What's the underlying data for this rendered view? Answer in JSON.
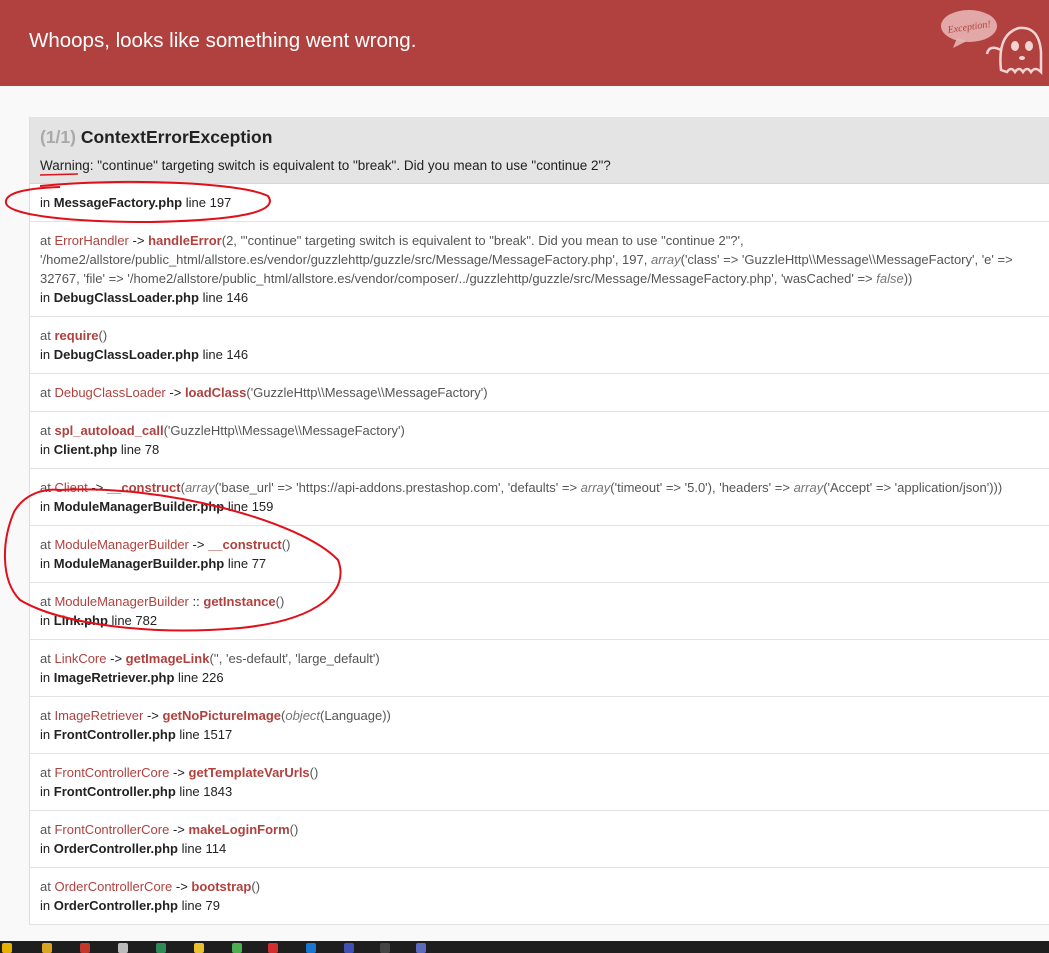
{
  "header": {
    "title": "Whoops, looks like something went wrong.",
    "mascot_text": "Exception!",
    "background_color": "#b0413e"
  },
  "exception": {
    "count": "(1/1)",
    "name": "ContextErrorException",
    "message": "Warning: \"continue\" targeting switch is equivalent to \"break\". Did you mean to use \"continue 2\"?"
  },
  "trace": [
    {
      "type": "location",
      "in": "in",
      "file": "MessageFactory.php",
      "line": "line 197"
    },
    {
      "type": "call",
      "at": "at",
      "class": "ErrorHandler",
      "sep": "->",
      "function": "handleError",
      "args": [
        {
          "t": "(2, '\"continue\" targeting switch is equivalent to \"break\". Did you mean to use \"continue 2\"?', '/home2/allstore/public_html/allstore.es/vendor/guzzlehttp/guzzle/src/Message/MessageFactory.php', 197, "
        },
        {
          "t": "array",
          "i": true
        },
        {
          "t": "('class' => 'GuzzleHttp\\\\Message\\\\MessageFactory', 'e' => 32767, 'file' => '/home2/allstore/public_html/allstore.es/vendor/composer/../guzzlehttp/guzzle/src/Message/MessageFactory.php', 'wasCached' => "
        },
        {
          "t": "false",
          "i": true
        },
        {
          "t": "))"
        }
      ],
      "in": "in",
      "file": "DebugClassLoader.php",
      "line": "line 146"
    },
    {
      "type": "call",
      "at": "at",
      "class": "",
      "sep": "",
      "function": "require",
      "args": [
        {
          "t": "()"
        }
      ],
      "in": "in",
      "file": "DebugClassLoader.php",
      "line": "line 146"
    },
    {
      "type": "call",
      "at": "at",
      "class": "DebugClassLoader",
      "sep": "->",
      "function": "loadClass",
      "args": [
        {
          "t": "('GuzzleHttp\\\\Message\\\\MessageFactory')"
        }
      ],
      "in": "",
      "file": "",
      "line": ""
    },
    {
      "type": "call",
      "at": "at",
      "class": "",
      "sep": "",
      "function": "spl_autoload_call",
      "args": [
        {
          "t": "('GuzzleHttp\\\\Message\\\\MessageFactory')"
        }
      ],
      "in": "in",
      "file": "Client.php",
      "line": "line 78"
    },
    {
      "type": "call",
      "at": "at",
      "class": "Client",
      "sep": "->",
      "function": "__construct",
      "args": [
        {
          "t": "("
        },
        {
          "t": "array",
          "i": true
        },
        {
          "t": "('base_url' => 'https://api-addons.prestashop.com', 'defaults' => "
        },
        {
          "t": "array",
          "i": true
        },
        {
          "t": "('timeout' => '5.0'), 'headers' => "
        },
        {
          "t": "array",
          "i": true
        },
        {
          "t": "('Accept' => 'application/json')))"
        }
      ],
      "in": "in",
      "file": "ModuleManagerBuilder.php",
      "line": "line 159"
    },
    {
      "type": "call",
      "at": "at",
      "class": "ModuleManagerBuilder",
      "sep": "->",
      "function": "__construct",
      "args": [
        {
          "t": "()"
        }
      ],
      "in": "in",
      "file": "ModuleManagerBuilder.php",
      "line": "line 77"
    },
    {
      "type": "call",
      "at": "at",
      "class": "ModuleManagerBuilder",
      "sep": "::",
      "function": "getInstance",
      "args": [
        {
          "t": "()"
        }
      ],
      "in": "in",
      "file": "Link.php",
      "line": "line 782"
    },
    {
      "type": "call",
      "at": "at",
      "class": "LinkCore",
      "sep": "->",
      "function": "getImageLink",
      "args": [
        {
          "t": "('', 'es-default', 'large_default')"
        }
      ],
      "in": "in",
      "file": "ImageRetriever.php",
      "line": "line 226"
    },
    {
      "type": "call",
      "at": "at",
      "class": "ImageRetriever",
      "sep": "->",
      "function": "getNoPictureImage",
      "args": [
        {
          "t": "("
        },
        {
          "t": "object",
          "i": true
        },
        {
          "t": "(Language))"
        }
      ],
      "in": "in",
      "file": "FrontController.php",
      "line": "line 1517"
    },
    {
      "type": "call",
      "at": "at",
      "class": "FrontControllerCore",
      "sep": "->",
      "function": "getTemplateVarUrls",
      "args": [
        {
          "t": "()"
        }
      ],
      "in": "in",
      "file": "FrontController.php",
      "line": "line 1843"
    },
    {
      "type": "call",
      "at": "at",
      "class": "FrontControllerCore",
      "sep": "->",
      "function": "makeLoginForm",
      "args": [
        {
          "t": "()"
        }
      ],
      "in": "in",
      "file": "OrderController.php",
      "line": "line 114"
    },
    {
      "type": "call",
      "at": "at",
      "class": "OrderControllerCore",
      "sep": "->",
      "function": "bootstrap",
      "args": [
        {
          "t": "()"
        }
      ],
      "in": "in",
      "file": "OrderController.php",
      "line": "line 79"
    }
  ],
  "annotation_color": "#e0101a"
}
